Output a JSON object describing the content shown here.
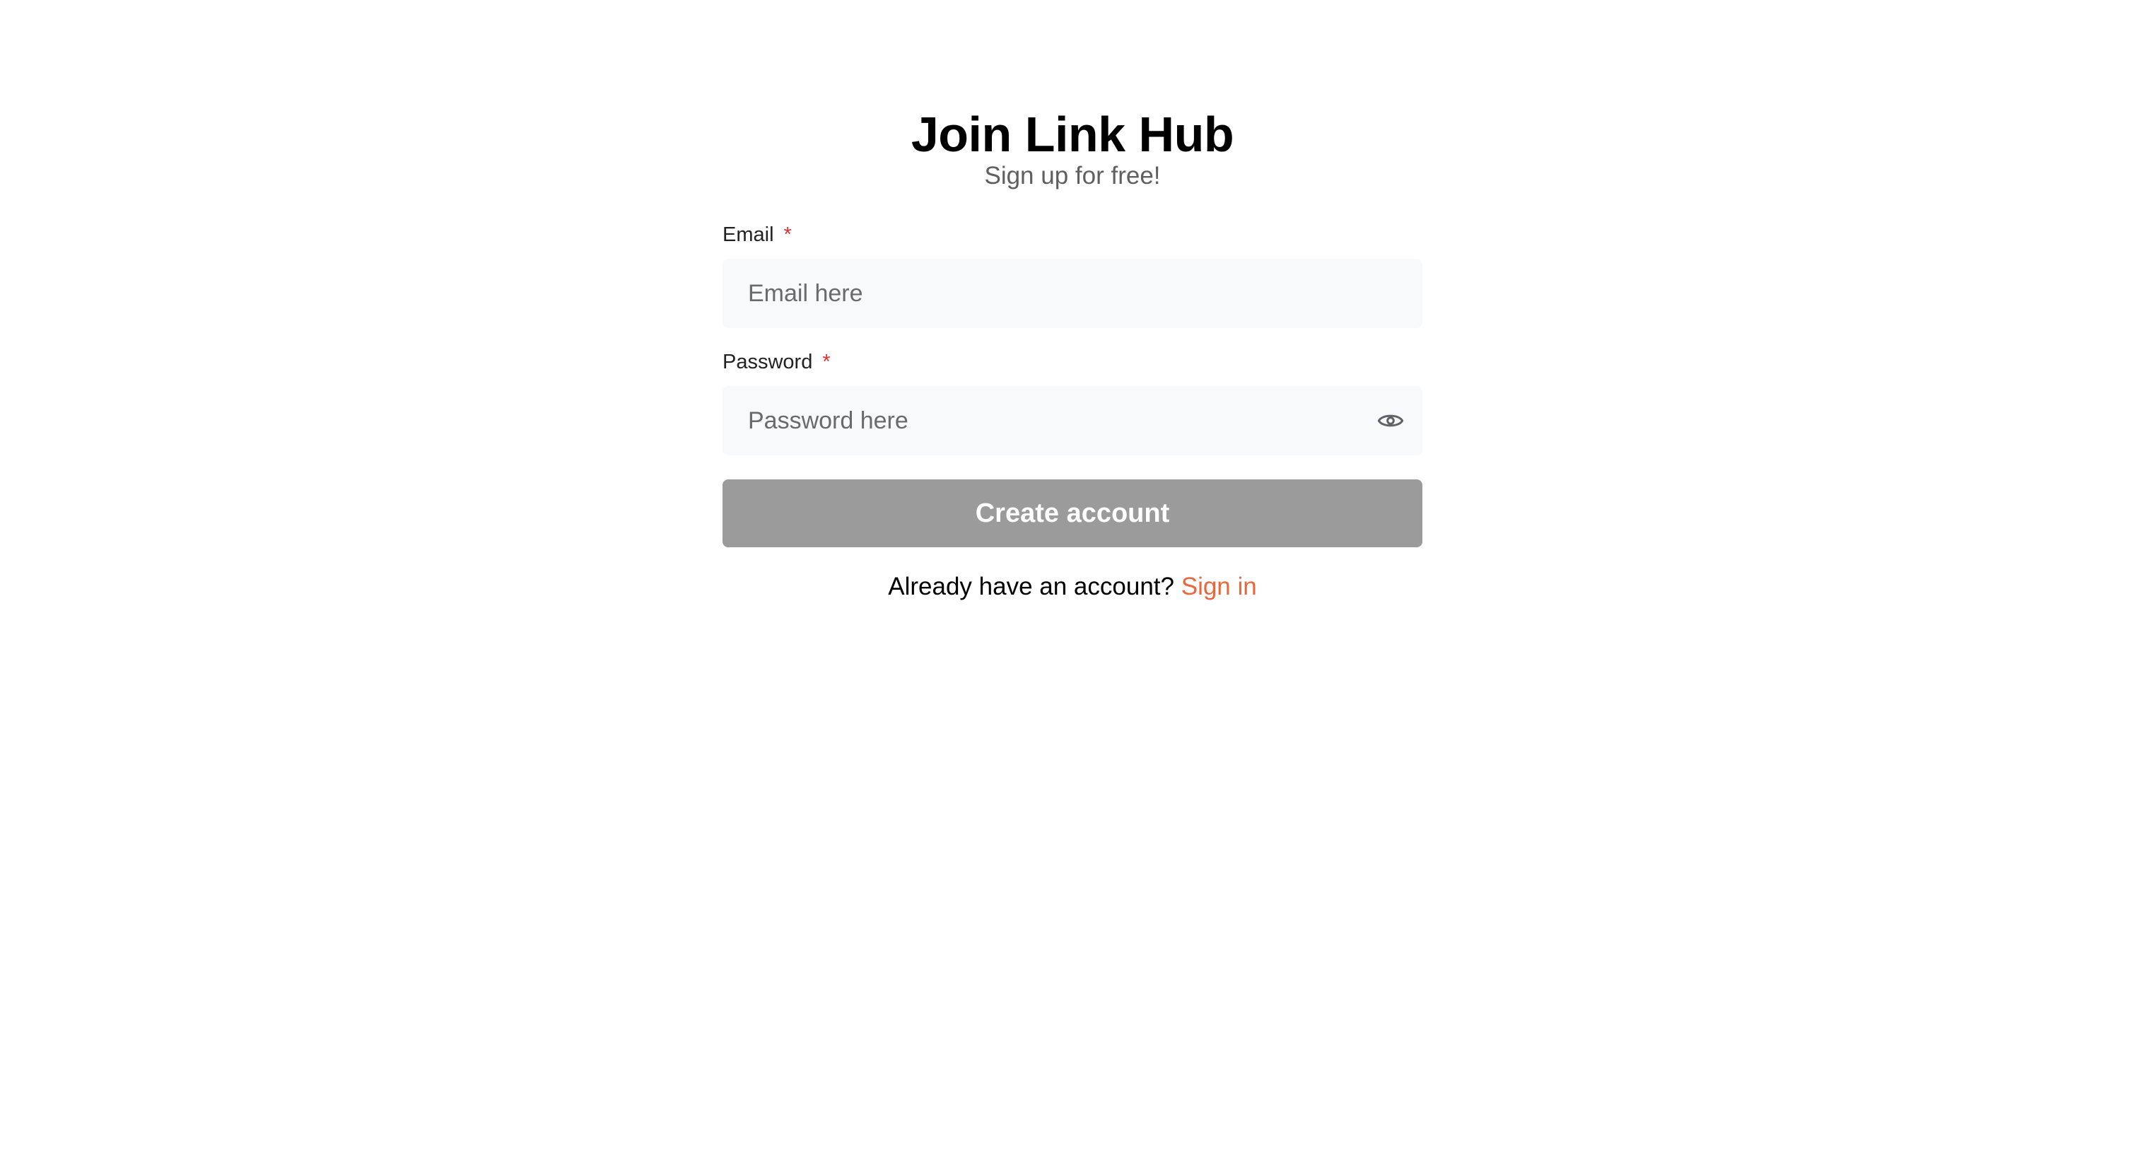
{
  "header": {
    "title": "Join Link Hub",
    "subtitle": "Sign up for free!"
  },
  "form": {
    "email": {
      "label": "Email",
      "required_marker": "*",
      "placeholder": "Email here",
      "value": ""
    },
    "password": {
      "label": "Password",
      "required_marker": "*",
      "placeholder": "Password here",
      "value": "",
      "toggle_icon": "eye-icon"
    },
    "submit_label": "Create account"
  },
  "footer": {
    "prompt": "Already have an account?",
    "link_label": "Sign in"
  },
  "colors": {
    "accent_link": "#e8673d",
    "required_star": "#e03131",
    "button_disabled": "#9b9b9b",
    "input_bg": "#f8f9fa"
  }
}
